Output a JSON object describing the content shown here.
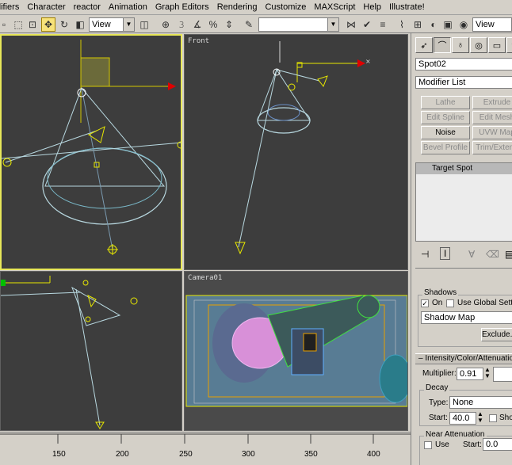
{
  "menu": [
    "difiers",
    "Character",
    "reactor",
    "Animation",
    "Graph Editors",
    "Rendering",
    "Customize",
    "MAXScript",
    "Help",
    "Illustrate!"
  ],
  "toolbar": {
    "selection_filter": "View",
    "named_selection": "",
    "ref_coord": "View"
  },
  "viewports": {
    "top_right_label": "Front",
    "bottom_right_label": "Camera01"
  },
  "timeline": {
    "ticks": [
      "150",
      "200",
      "250",
      "300",
      "350",
      "400"
    ]
  },
  "command_panel": {
    "object_name": "Spot02",
    "modifier_list": "Modifier List",
    "modifier_buttons": [
      {
        "label": "Lathe",
        "on": false
      },
      {
        "label": "Extrude",
        "on": false
      },
      {
        "label": "Edit Spline",
        "on": false
      },
      {
        "label": "Edit Mesh",
        "on": false
      },
      {
        "label": "Noise",
        "on": true
      },
      {
        "label": "UVW Map",
        "on": false
      },
      {
        "label": "Bevel Profile",
        "on": false
      },
      {
        "label": "Trim/Extend",
        "on": false
      }
    ],
    "stack_item": "Target Spot",
    "shadows": {
      "title": "Shadows",
      "on_label": "On",
      "global_label": "Use Global Settings",
      "type": "Shadow Map",
      "exclude_label": "Exclude..."
    },
    "intensity": {
      "title": "Intensity/Color/Attenuation",
      "multiplier_label": "Multiplier:",
      "multiplier": "0.91",
      "decay_title": "Decay",
      "type_label": "Type:",
      "type_value": "None",
      "start_label": "Start:",
      "start_value": "40.0",
      "show_label": "Show",
      "near_title": "Near Attenuation",
      "use_label": "Use",
      "near_start_label": "Start:",
      "near_start": "0.0"
    }
  }
}
